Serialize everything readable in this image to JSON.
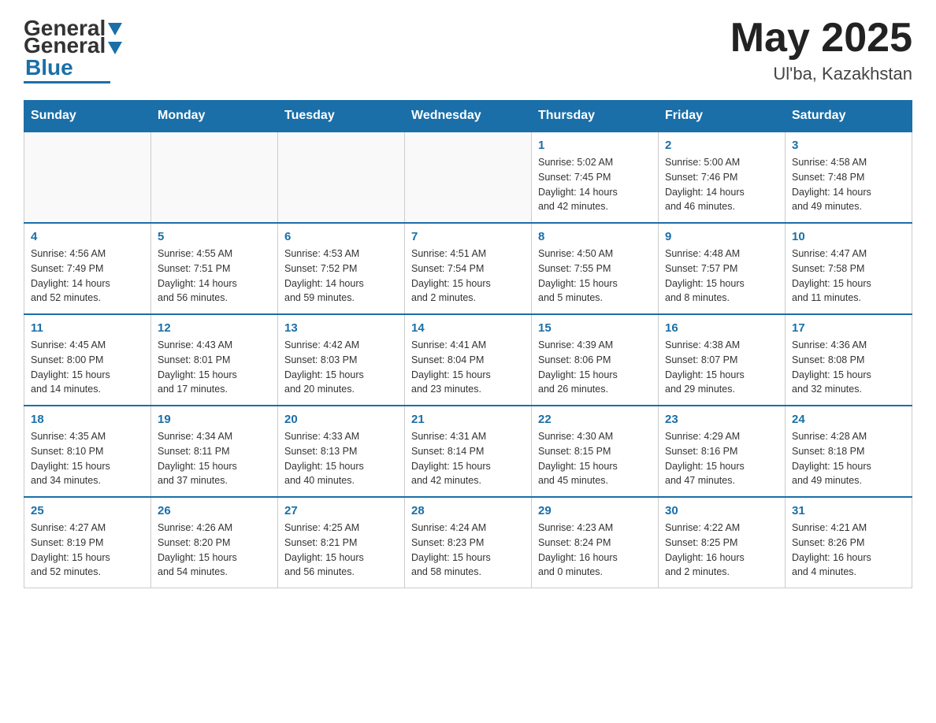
{
  "header": {
    "logo_general": "General",
    "logo_blue": "Blue",
    "month": "May 2025",
    "location": "Ul'ba, Kazakhstan"
  },
  "weekdays": [
    "Sunday",
    "Monday",
    "Tuesday",
    "Wednesday",
    "Thursday",
    "Friday",
    "Saturday"
  ],
  "weeks": [
    [
      {
        "day": "",
        "info": ""
      },
      {
        "day": "",
        "info": ""
      },
      {
        "day": "",
        "info": ""
      },
      {
        "day": "",
        "info": ""
      },
      {
        "day": "1",
        "info": "Sunrise: 5:02 AM\nSunset: 7:45 PM\nDaylight: 14 hours\nand 42 minutes."
      },
      {
        "day": "2",
        "info": "Sunrise: 5:00 AM\nSunset: 7:46 PM\nDaylight: 14 hours\nand 46 minutes."
      },
      {
        "day": "3",
        "info": "Sunrise: 4:58 AM\nSunset: 7:48 PM\nDaylight: 14 hours\nand 49 minutes."
      }
    ],
    [
      {
        "day": "4",
        "info": "Sunrise: 4:56 AM\nSunset: 7:49 PM\nDaylight: 14 hours\nand 52 minutes."
      },
      {
        "day": "5",
        "info": "Sunrise: 4:55 AM\nSunset: 7:51 PM\nDaylight: 14 hours\nand 56 minutes."
      },
      {
        "day": "6",
        "info": "Sunrise: 4:53 AM\nSunset: 7:52 PM\nDaylight: 14 hours\nand 59 minutes."
      },
      {
        "day": "7",
        "info": "Sunrise: 4:51 AM\nSunset: 7:54 PM\nDaylight: 15 hours\nand 2 minutes."
      },
      {
        "day": "8",
        "info": "Sunrise: 4:50 AM\nSunset: 7:55 PM\nDaylight: 15 hours\nand 5 minutes."
      },
      {
        "day": "9",
        "info": "Sunrise: 4:48 AM\nSunset: 7:57 PM\nDaylight: 15 hours\nand 8 minutes."
      },
      {
        "day": "10",
        "info": "Sunrise: 4:47 AM\nSunset: 7:58 PM\nDaylight: 15 hours\nand 11 minutes."
      }
    ],
    [
      {
        "day": "11",
        "info": "Sunrise: 4:45 AM\nSunset: 8:00 PM\nDaylight: 15 hours\nand 14 minutes."
      },
      {
        "day": "12",
        "info": "Sunrise: 4:43 AM\nSunset: 8:01 PM\nDaylight: 15 hours\nand 17 minutes."
      },
      {
        "day": "13",
        "info": "Sunrise: 4:42 AM\nSunset: 8:03 PM\nDaylight: 15 hours\nand 20 minutes."
      },
      {
        "day": "14",
        "info": "Sunrise: 4:41 AM\nSunset: 8:04 PM\nDaylight: 15 hours\nand 23 minutes."
      },
      {
        "day": "15",
        "info": "Sunrise: 4:39 AM\nSunset: 8:06 PM\nDaylight: 15 hours\nand 26 minutes."
      },
      {
        "day": "16",
        "info": "Sunrise: 4:38 AM\nSunset: 8:07 PM\nDaylight: 15 hours\nand 29 minutes."
      },
      {
        "day": "17",
        "info": "Sunrise: 4:36 AM\nSunset: 8:08 PM\nDaylight: 15 hours\nand 32 minutes."
      }
    ],
    [
      {
        "day": "18",
        "info": "Sunrise: 4:35 AM\nSunset: 8:10 PM\nDaylight: 15 hours\nand 34 minutes."
      },
      {
        "day": "19",
        "info": "Sunrise: 4:34 AM\nSunset: 8:11 PM\nDaylight: 15 hours\nand 37 minutes."
      },
      {
        "day": "20",
        "info": "Sunrise: 4:33 AM\nSunset: 8:13 PM\nDaylight: 15 hours\nand 40 minutes."
      },
      {
        "day": "21",
        "info": "Sunrise: 4:31 AM\nSunset: 8:14 PM\nDaylight: 15 hours\nand 42 minutes."
      },
      {
        "day": "22",
        "info": "Sunrise: 4:30 AM\nSunset: 8:15 PM\nDaylight: 15 hours\nand 45 minutes."
      },
      {
        "day": "23",
        "info": "Sunrise: 4:29 AM\nSunset: 8:16 PM\nDaylight: 15 hours\nand 47 minutes."
      },
      {
        "day": "24",
        "info": "Sunrise: 4:28 AM\nSunset: 8:18 PM\nDaylight: 15 hours\nand 49 minutes."
      }
    ],
    [
      {
        "day": "25",
        "info": "Sunrise: 4:27 AM\nSunset: 8:19 PM\nDaylight: 15 hours\nand 52 minutes."
      },
      {
        "day": "26",
        "info": "Sunrise: 4:26 AM\nSunset: 8:20 PM\nDaylight: 15 hours\nand 54 minutes."
      },
      {
        "day": "27",
        "info": "Sunrise: 4:25 AM\nSunset: 8:21 PM\nDaylight: 15 hours\nand 56 minutes."
      },
      {
        "day": "28",
        "info": "Sunrise: 4:24 AM\nSunset: 8:23 PM\nDaylight: 15 hours\nand 58 minutes."
      },
      {
        "day": "29",
        "info": "Sunrise: 4:23 AM\nSunset: 8:24 PM\nDaylight: 16 hours\nand 0 minutes."
      },
      {
        "day": "30",
        "info": "Sunrise: 4:22 AM\nSunset: 8:25 PM\nDaylight: 16 hours\nand 2 minutes."
      },
      {
        "day": "31",
        "info": "Sunrise: 4:21 AM\nSunset: 8:26 PM\nDaylight: 16 hours\nand 4 minutes."
      }
    ]
  ]
}
